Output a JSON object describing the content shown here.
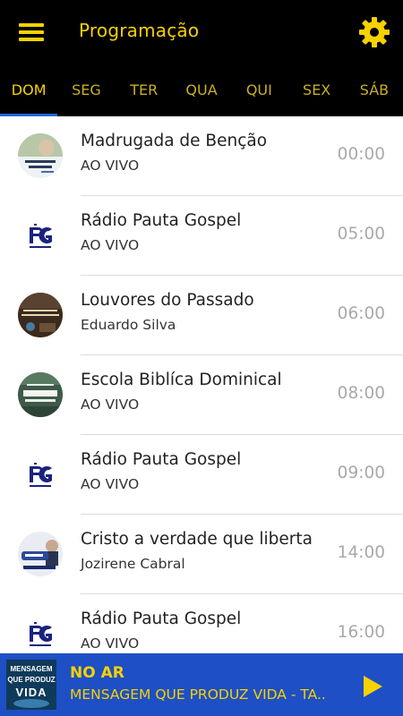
{
  "header": {
    "title": "Programação",
    "menu_icon": "menu-icon",
    "settings_icon": "gear-icon"
  },
  "accent": "#f6d200",
  "tabs": [
    {
      "label": "DOM",
      "active": true
    },
    {
      "label": "SEG"
    },
    {
      "label": "TER"
    },
    {
      "label": "QUA"
    },
    {
      "label": "QUI"
    },
    {
      "label": "SEX"
    },
    {
      "label": "SÁB"
    }
  ],
  "programs": [
    {
      "title": "Madrugada de Benção",
      "subtitle": "AO VIVO",
      "time": "00:00"
    },
    {
      "title": "Rádio Pauta Gospel",
      "subtitle": "AO VIVO",
      "time": "05:00"
    },
    {
      "title": "Louvores do Passado",
      "subtitle": "Eduardo Silva",
      "time": "06:00"
    },
    {
      "title": "Escola Biblíca Dominical",
      "subtitle": "AO VIVO",
      "time": "08:00"
    },
    {
      "title": "Rádio Pauta Gospel",
      "subtitle": "AO VIVO",
      "time": "09:00"
    },
    {
      "title": "Cristo a verdade que liberta",
      "subtitle": "Jozirene Cabral",
      "time": "14:00"
    },
    {
      "title": "Rádio Pauta Gospel",
      "subtitle": "AO VIVO",
      "time": "16:00"
    }
  ],
  "player": {
    "status": "NO AR",
    "now_playing": "MENSAGEM QUE PRODUZ VIDA - TA..",
    "thumb_line1": "MENSAGEM",
    "thumb_line2": "QUE PRODUZ",
    "thumb_line3": "VIDA",
    "play_icon": "play-icon"
  }
}
